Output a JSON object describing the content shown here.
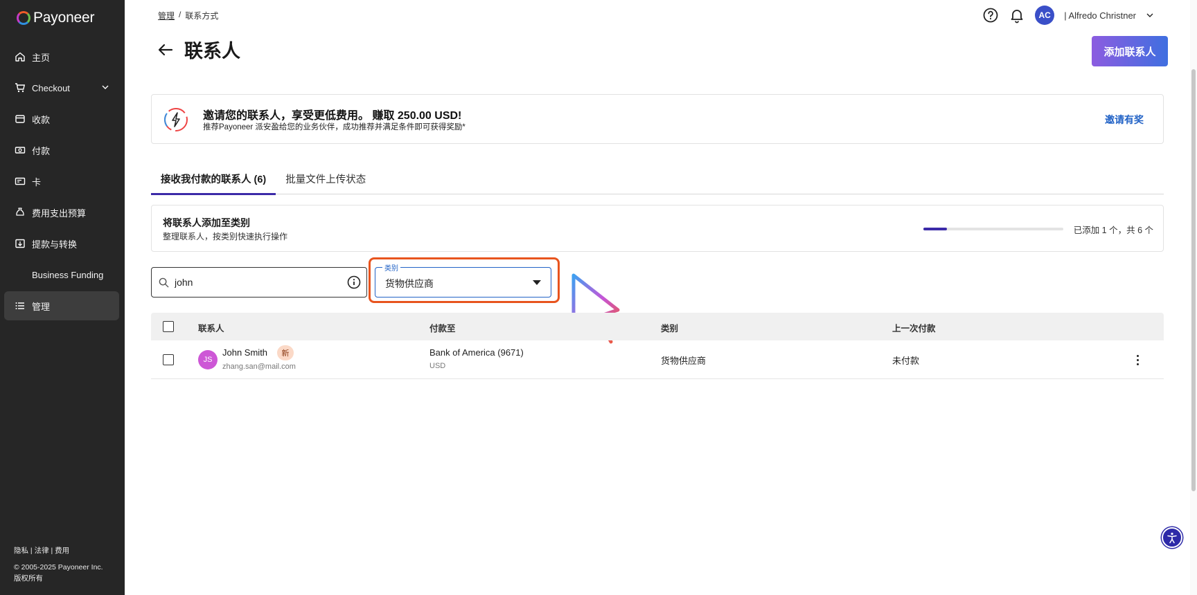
{
  "brand": {
    "name": "Payoneer"
  },
  "sidebar": {
    "items": [
      {
        "label": "主页",
        "icon": "home-icon"
      },
      {
        "label": "Checkout",
        "icon": "cart-icon",
        "has_chevron": true
      },
      {
        "label": "收款",
        "icon": "inbox-icon"
      },
      {
        "label": "付款",
        "icon": "payment-icon"
      },
      {
        "label": "卡",
        "icon": "card-icon"
      },
      {
        "label": "费用支出预算",
        "icon": "budget-icon"
      },
      {
        "label": "提款与转换",
        "icon": "withdraw-icon"
      },
      {
        "label": "Business Funding",
        "icon": "funding-icon"
      },
      {
        "label": "管理",
        "icon": "list-icon",
        "active": true
      }
    ],
    "footer": {
      "links": [
        "隐私",
        "法律",
        "费用"
      ],
      "separator": "|",
      "copyright": "© 2005-2025 Payoneer Inc.",
      "rights": "版权所有"
    }
  },
  "header": {
    "breadcrumb": {
      "parent": "管理",
      "separator": "/",
      "current": "联系方式"
    },
    "title": "联系人",
    "user": {
      "initials": "AC",
      "name": "| Alfredo Christner"
    },
    "add_button": "添加联系人"
  },
  "promo": {
    "title": "邀请您的联系人，享受更低费用。 赚取 250.00 USD!",
    "subtitle": "推荐Payoneer 派安盈给您的业务伙伴，成功推荐并满足条件即可获得奖励*",
    "link": "邀请有奖"
  },
  "tabs": [
    {
      "label": "接收我付款的联系人 (6)",
      "active": true
    },
    {
      "label": "批量文件上传状态",
      "active": false
    }
  ],
  "category_card": {
    "title": "将联系人添加至类别",
    "subtitle": "整理联系人，按类别快速执行操作",
    "progress_fraction": 0.167,
    "progress_text": "已添加 1 个，共 6 个"
  },
  "filters": {
    "search_value": "john",
    "category_label": "类别",
    "category_value": "货物供应商"
  },
  "table": {
    "columns": [
      "联系人",
      "付款至",
      "类别",
      "上一次付款"
    ],
    "rows": [
      {
        "initials": "JS",
        "name": "John Smith",
        "badge": "新",
        "email": "zhang.san@mail.com",
        "bank": "Bank of America (9671)",
        "currency": "USD",
        "category": "货物供应商",
        "last_payment": "未付款"
      }
    ]
  },
  "colors": {
    "sidebar_bg": "#262626",
    "accent": "#3b2aa8",
    "link": "#2162c6",
    "highlight": "#e8541e",
    "avatar_row": "#cd57d6",
    "user_avatar": "#3a4fc8"
  }
}
